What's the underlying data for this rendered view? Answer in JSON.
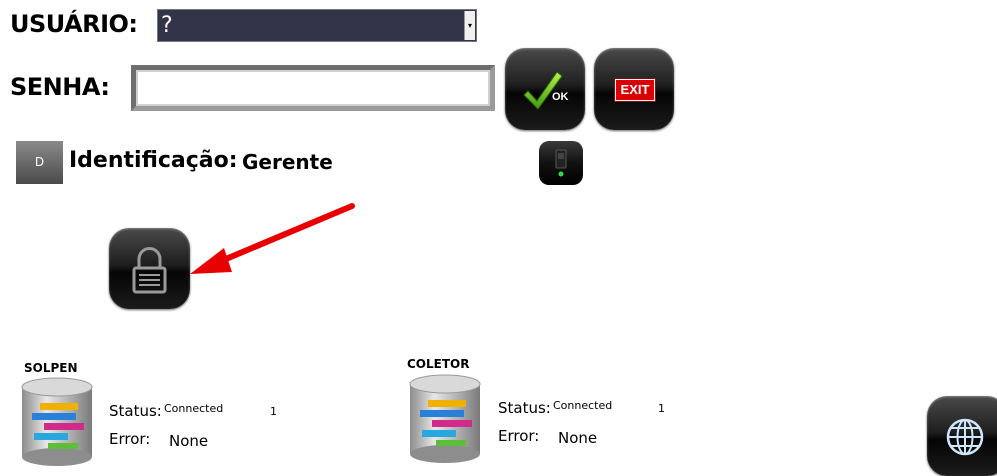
{
  "login": {
    "user_label": "USUÁRIO:",
    "user_value": "?",
    "password_label": "SENHA:",
    "password_value": "",
    "ok_label": "OK",
    "exit_label": "EXIT"
  },
  "identification": {
    "badge": "D",
    "label": "Identificação:",
    "value": "Gerente"
  },
  "databases": [
    {
      "title": "SOLPEN",
      "status_label": "Status:",
      "status_value": "Connected",
      "count": "1",
      "error_label": "Error:",
      "error_value": "None"
    },
    {
      "title": "COLETOR",
      "status_label": "Status:",
      "status_value": "Connected",
      "count": "1",
      "error_label": "Error:",
      "error_value": "None"
    }
  ],
  "colors": {
    "annotation_arrow": "#e60000",
    "select_bg": "#33334a",
    "button_dark": "#111111"
  },
  "icons": [
    "check-icon",
    "exit-icon",
    "device-icon",
    "lock-icon",
    "database-icon",
    "globe-icon"
  ]
}
